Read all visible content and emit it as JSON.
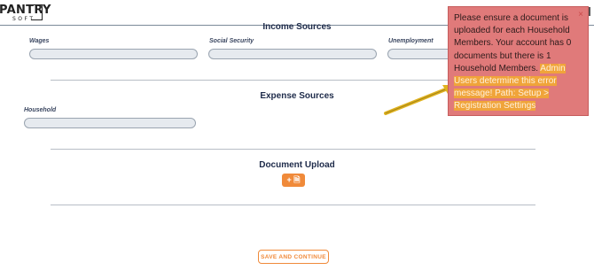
{
  "header": {
    "logo_text_top": "PANTRY",
    "logo_text_bottom": "SOFT"
  },
  "income": {
    "title": "Income Sources",
    "fields": [
      {
        "label": "Wages",
        "value": ""
      },
      {
        "label": "Social Security",
        "value": ""
      },
      {
        "label": "Unemployment",
        "value": ""
      }
    ]
  },
  "expense": {
    "title": "Expense Sources",
    "fields": [
      {
        "label": "Household",
        "value": ""
      }
    ]
  },
  "documents": {
    "title": "Document Upload",
    "upload_label": "+ 🗎"
  },
  "actions": {
    "save_label": "SAVE AND CONTINUE"
  },
  "toast": {
    "close_label": "×",
    "message_main": "Please ensure a document is uploaded for each Household Members. Your account has 0 documents but there is 1 Household Members.",
    "message_highlight": "Admin Users determine this error message! Path: Setup > Registration Settings",
    "colors": {
      "background": "#e07a7a",
      "highlight": "#f0a43a",
      "arrow": "#e0b21f"
    }
  },
  "colors": {
    "accent": "#f08a3a",
    "input_bg": "#e6eaef",
    "title": "#1e2b4a"
  }
}
